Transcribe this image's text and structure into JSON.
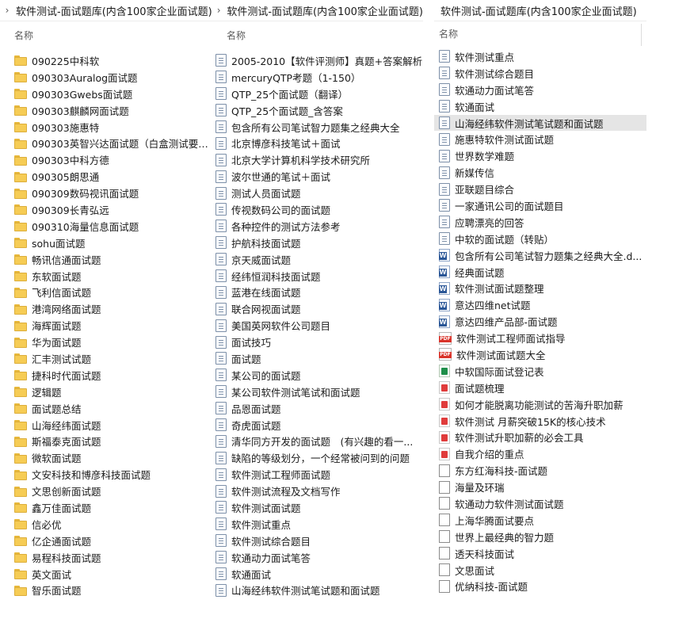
{
  "panes": [
    {
      "header": "软件测试-面试题库(内含100家企业面试题)",
      "column": "名称",
      "items": [
        {
          "icon": "folder",
          "label": "090225中科软"
        },
        {
          "icon": "folder",
          "label": "090303Auralog面试题"
        },
        {
          "icon": "folder",
          "label": "090303Gwebs面试题"
        },
        {
          "icon": "folder",
          "label": "090303麒麟网面试题"
        },
        {
          "icon": "folder",
          "label": "090303施惠特"
        },
        {
          "icon": "folder",
          "label": "090303英智兴达面试题（白盒测试要求..."
        },
        {
          "icon": "folder",
          "label": "090303中科方德"
        },
        {
          "icon": "folder",
          "label": "090305朗思通"
        },
        {
          "icon": "folder",
          "label": "090309数码视讯面试题"
        },
        {
          "icon": "folder",
          "label": "090309长青弘远"
        },
        {
          "icon": "folder",
          "label": "090310海量信息面试题"
        },
        {
          "icon": "folder",
          "label": "sohu面试题"
        },
        {
          "icon": "folder",
          "label": "畅讯信通面试题"
        },
        {
          "icon": "folder",
          "label": "东软面试题"
        },
        {
          "icon": "folder",
          "label": "飞利信面试题"
        },
        {
          "icon": "folder",
          "label": "港湾网络面试题"
        },
        {
          "icon": "folder",
          "label": "海辉面试题"
        },
        {
          "icon": "folder",
          "label": "华为面试题"
        },
        {
          "icon": "folder",
          "label": "汇丰测试试题"
        },
        {
          "icon": "folder",
          "label": "捷科时代面试题"
        },
        {
          "icon": "folder",
          "label": "逻辑题"
        },
        {
          "icon": "folder",
          "label": "面试题总结"
        },
        {
          "icon": "folder",
          "label": "山海经纬面试题"
        },
        {
          "icon": "folder",
          "label": "斯福泰克面试题"
        },
        {
          "icon": "folder",
          "label": "微软面试题"
        },
        {
          "icon": "folder",
          "label": "文安科技和博彦科技面试题"
        },
        {
          "icon": "folder",
          "label": "文思创新面试题"
        },
        {
          "icon": "folder",
          "label": "鑫万佳面试题"
        },
        {
          "icon": "folder",
          "label": "信必优"
        },
        {
          "icon": "folder",
          "label": "亿企通面试题"
        },
        {
          "icon": "folder",
          "label": "易程科技面试题"
        },
        {
          "icon": "folder",
          "label": "英文面试"
        },
        {
          "icon": "folder",
          "label": "智乐面试题"
        }
      ]
    },
    {
      "header": "软件测试-面试题库(内含100家企业面试题)",
      "column": "名称",
      "items": [
        {
          "icon": "doc",
          "label": "2005-2010【软件评测师】真题+答案解析"
        },
        {
          "icon": "doc",
          "label": "mercuryQTP考题（1-150）"
        },
        {
          "icon": "doc",
          "label": "QTP_25个面试题（翻译）"
        },
        {
          "icon": "doc",
          "label": "QTP_25个面试题_含答案"
        },
        {
          "icon": "doc",
          "label": "包含所有公司笔试智力题集之经典大全"
        },
        {
          "icon": "doc",
          "label": "北京博彦科技笔试＋面试"
        },
        {
          "icon": "doc",
          "label": "北京大学计算机科学技术研究所"
        },
        {
          "icon": "doc",
          "label": "波尔世通的笔试＋面试"
        },
        {
          "icon": "doc",
          "label": "测试人员面试题"
        },
        {
          "icon": "doc",
          "label": "传视数码公司的面试题"
        },
        {
          "icon": "doc",
          "label": "各种控件的测试方法参考"
        },
        {
          "icon": "doc",
          "label": "护航科技面试题"
        },
        {
          "icon": "doc",
          "label": "京天威面试题"
        },
        {
          "icon": "doc",
          "label": "经纬恒润科技面试题"
        },
        {
          "icon": "doc",
          "label": "蓝港在线面试题"
        },
        {
          "icon": "doc",
          "label": "联合网视面试题"
        },
        {
          "icon": "doc",
          "label": "美国英网软件公司题目"
        },
        {
          "icon": "doc",
          "label": "面试技巧"
        },
        {
          "icon": "doc",
          "label": "面试题"
        },
        {
          "icon": "doc",
          "label": "某公司的面试题"
        },
        {
          "icon": "doc",
          "label": "某公司软件测试笔试和面试题"
        },
        {
          "icon": "doc",
          "label": "品恩面试题"
        },
        {
          "icon": "doc",
          "label": "奇虎面试题"
        },
        {
          "icon": "doc",
          "label": "清华同方开发的面试题　(有兴趣的看一..."
        },
        {
          "icon": "doc",
          "label": "缺陷的等级划分，一个经常被问到的问题"
        },
        {
          "icon": "doc",
          "label": "软件测试工程师面试题"
        },
        {
          "icon": "doc",
          "label": "软件测试流程及文档写作"
        },
        {
          "icon": "doc",
          "label": "软件测试面试题"
        },
        {
          "icon": "doc",
          "label": "软件测试重点"
        },
        {
          "icon": "doc",
          "label": "软件测试综合题目"
        },
        {
          "icon": "doc",
          "label": "软通动力面试笔答"
        },
        {
          "icon": "doc",
          "label": "软通面试"
        },
        {
          "icon": "doc",
          "label": "山海经纬软件测试笔试题和面试题"
        }
      ]
    },
    {
      "header": "软件测试-面试题库(内含100家企业面试题)",
      "column": "名称",
      "items": [
        {
          "icon": "doc",
          "label": "软件测试重点"
        },
        {
          "icon": "doc",
          "label": "软件测试综合题目"
        },
        {
          "icon": "doc",
          "label": "软通动力面试笔答"
        },
        {
          "icon": "doc",
          "label": "软通面试"
        },
        {
          "icon": "doc",
          "label": "山海经纬软件测试笔试题和面试题",
          "selected": true
        },
        {
          "icon": "doc",
          "label": "施惠特软件测试面试题"
        },
        {
          "icon": "doc",
          "label": "世界数学难题"
        },
        {
          "icon": "doc",
          "label": "新媒传信"
        },
        {
          "icon": "doc",
          "label": "亚联题目综合"
        },
        {
          "icon": "doc",
          "label": "一家通讯公司的面试题目"
        },
        {
          "icon": "doc",
          "label": "应聘漂亮的回答"
        },
        {
          "icon": "doc",
          "label": "中软的面试题（转贴）"
        },
        {
          "icon": "word",
          "label": "包含所有公司笔试智力题集之经典大全.d..."
        },
        {
          "icon": "word",
          "label": "经典面试题"
        },
        {
          "icon": "word",
          "label": "软件测试面试题整理"
        },
        {
          "icon": "word",
          "label": "意达四维net试题"
        },
        {
          "icon": "word",
          "label": "意达四维产品部-面试题"
        },
        {
          "icon": "pdf",
          "label": "软件测试工程师面试指导"
        },
        {
          "icon": "pdf",
          "label": "软件测试面试题大全"
        },
        {
          "icon": "xls",
          "label": "中软国际面试登记表"
        },
        {
          "icon": "pdf2",
          "label": "面试题梳理"
        },
        {
          "icon": "pdf2",
          "label": "如何才能脱离功能测试的苦海升职加薪"
        },
        {
          "icon": "pdf2",
          "label": "软件测试 月薪突破15K的核心技术"
        },
        {
          "icon": "pdf2",
          "label": "软件测试升职加薪的必会工具"
        },
        {
          "icon": "pdf2",
          "label": "自我介绍的重点"
        },
        {
          "icon": "blank",
          "label": "东方红海科技-面试题"
        },
        {
          "icon": "blank",
          "label": "海量及环瑞"
        },
        {
          "icon": "blank",
          "label": "软通动力软件测试面试题"
        },
        {
          "icon": "blank",
          "label": "上海华腾面试要点"
        },
        {
          "icon": "blank",
          "label": "世界上最经典的智力题"
        },
        {
          "icon": "blank",
          "label": "透天科技面试"
        },
        {
          "icon": "blank",
          "label": "文思面试"
        },
        {
          "icon": "blank",
          "label": "优纳科技-面试题"
        }
      ]
    }
  ]
}
